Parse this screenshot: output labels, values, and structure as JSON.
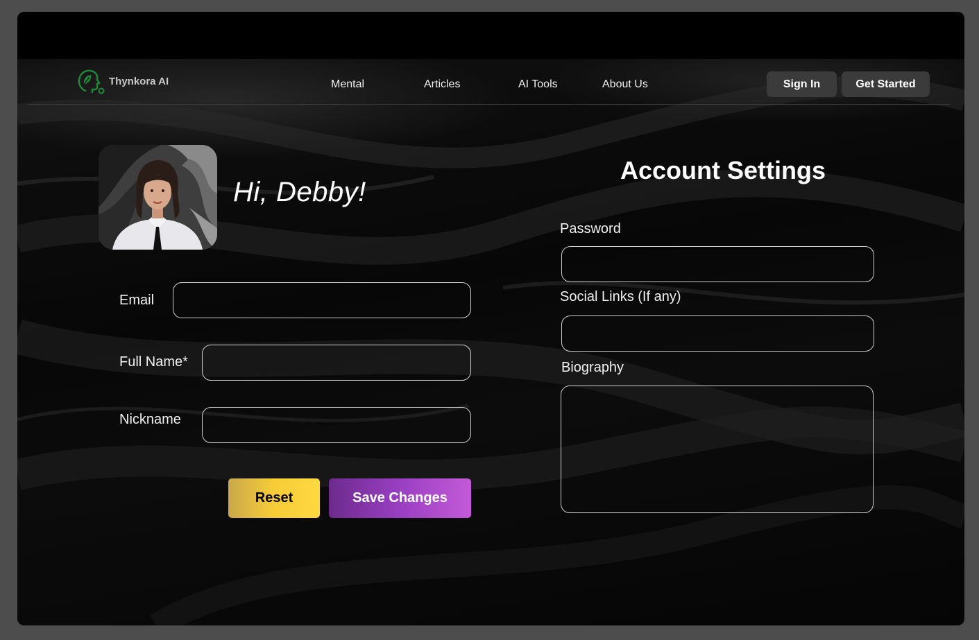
{
  "brand": {
    "name": "Thynkora AI",
    "accent_color": "#1f8a3a"
  },
  "nav": {
    "links": [
      "Mental",
      "Articles",
      "AI Tools",
      "About Us"
    ],
    "sign_in": "Sign In",
    "get_started": "Get Started"
  },
  "profile": {
    "greeting": "Hi, Debby!",
    "email_label": "Email",
    "email_value": "",
    "full_name_label": "Full Name*",
    "full_name_value": "",
    "nickname_label": "Nickname",
    "nickname_value": "",
    "reset_label": "Reset",
    "save_label": "Save Changes"
  },
  "settings": {
    "title": "Account Settings",
    "password_label": "Password",
    "password_value": "",
    "social_label": "Social Links (If any)",
    "social_value": "",
    "bio_label": "Biography",
    "bio_value": ""
  },
  "colors": {
    "reset_button": "#f7cc37",
    "save_button": "#9a3fc2",
    "nav_button": "#3b3b3b"
  }
}
